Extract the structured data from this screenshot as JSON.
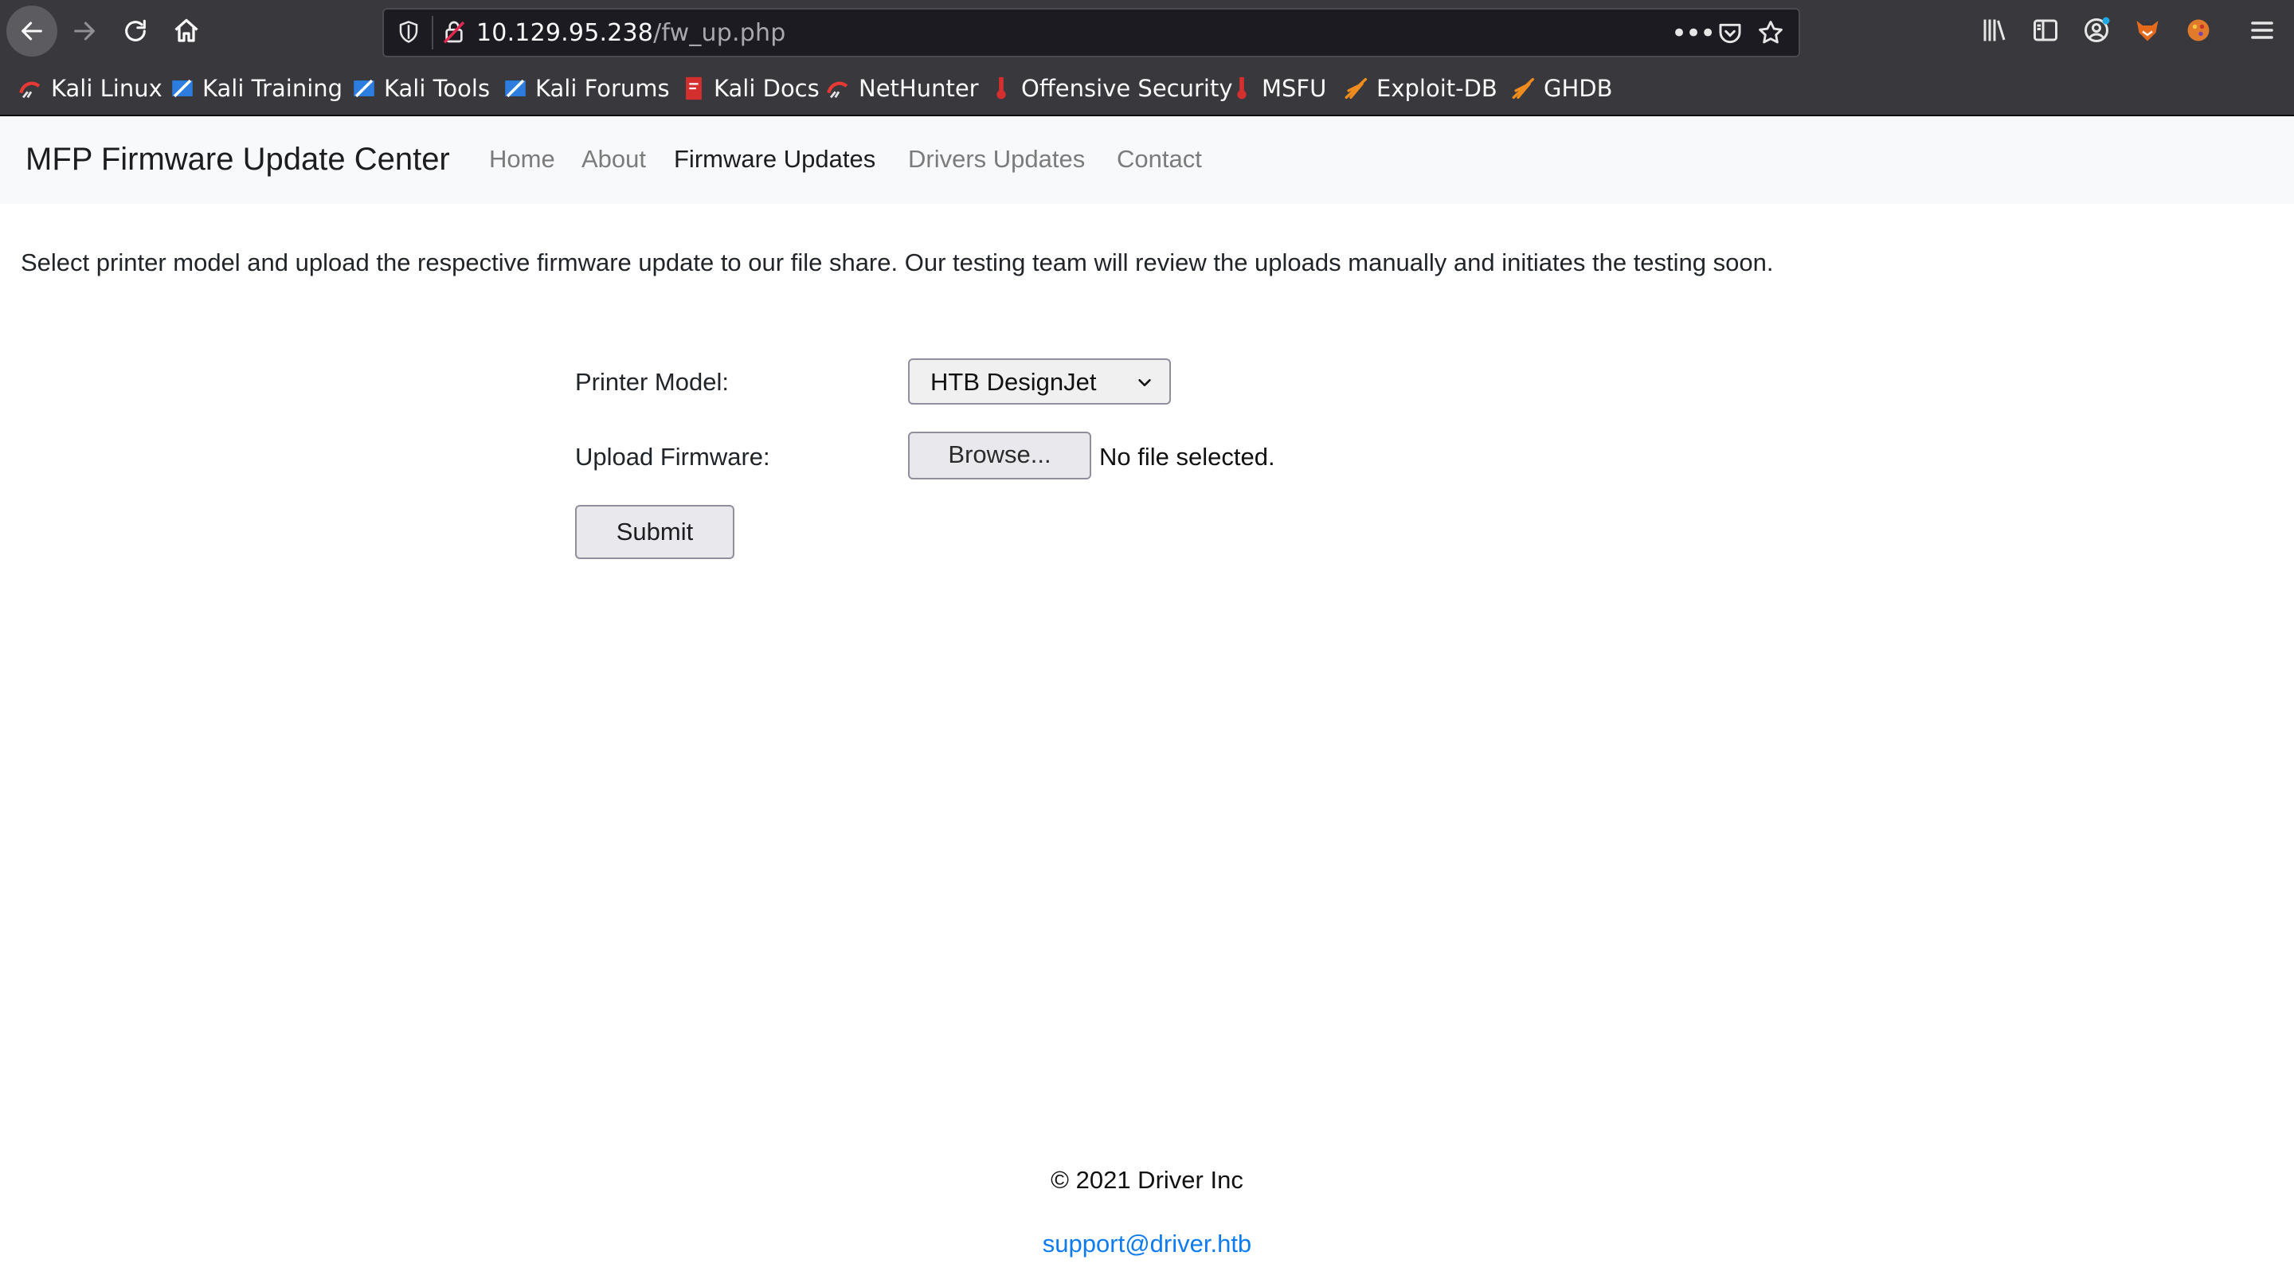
{
  "browser": {
    "url_host": "10.129.95.238",
    "url_path": "/fw_up.php",
    "more_label": "•••",
    "bookmarks": [
      {
        "label": "Kali Linux",
        "icon": "kali-dragon-icon"
      },
      {
        "label": "Kali Training",
        "icon": "kali-training-icon"
      },
      {
        "label": "Kali Tools",
        "icon": "kali-tools-icon"
      },
      {
        "label": "Kali Forums",
        "icon": "kali-forums-icon"
      },
      {
        "label": "Kali Docs",
        "icon": "kali-docs-icon"
      },
      {
        "label": "NetHunter",
        "icon": "nethunter-icon"
      },
      {
        "label": "Offensive Security",
        "icon": "offsec-icon"
      },
      {
        "label": "MSFU",
        "icon": "msfu-icon"
      },
      {
        "label": "Exploit-DB",
        "icon": "exploit-db-icon"
      },
      {
        "label": "GHDB",
        "icon": "ghdb-icon"
      }
    ]
  },
  "navbar": {
    "brand": "MFP Firmware Update Center",
    "links": [
      {
        "label": "Home"
      },
      {
        "label": "About"
      },
      {
        "label": "Firmware Updates",
        "active": true
      },
      {
        "label": "Drivers Updates"
      },
      {
        "label": "Contact"
      }
    ]
  },
  "main": {
    "intro": "Select printer model and upload the respective firmware update to our file share. Our testing team will review the uploads manually and initiates the testing soon.",
    "printer_model_label": "Printer Model:",
    "printer_model_value": "HTB DesignJet",
    "upload_label": "Upload Firmware:",
    "browse_label": "Browse...",
    "no_file": "No file selected.",
    "submit_label": "Submit"
  },
  "footer": {
    "copyright": "© 2021 Driver Inc",
    "email": "support@driver.htb"
  },
  "colors": {
    "toolbar": "#38383d",
    "link": "#0d7cf2",
    "navbar_bg": "#f8f9fa"
  }
}
